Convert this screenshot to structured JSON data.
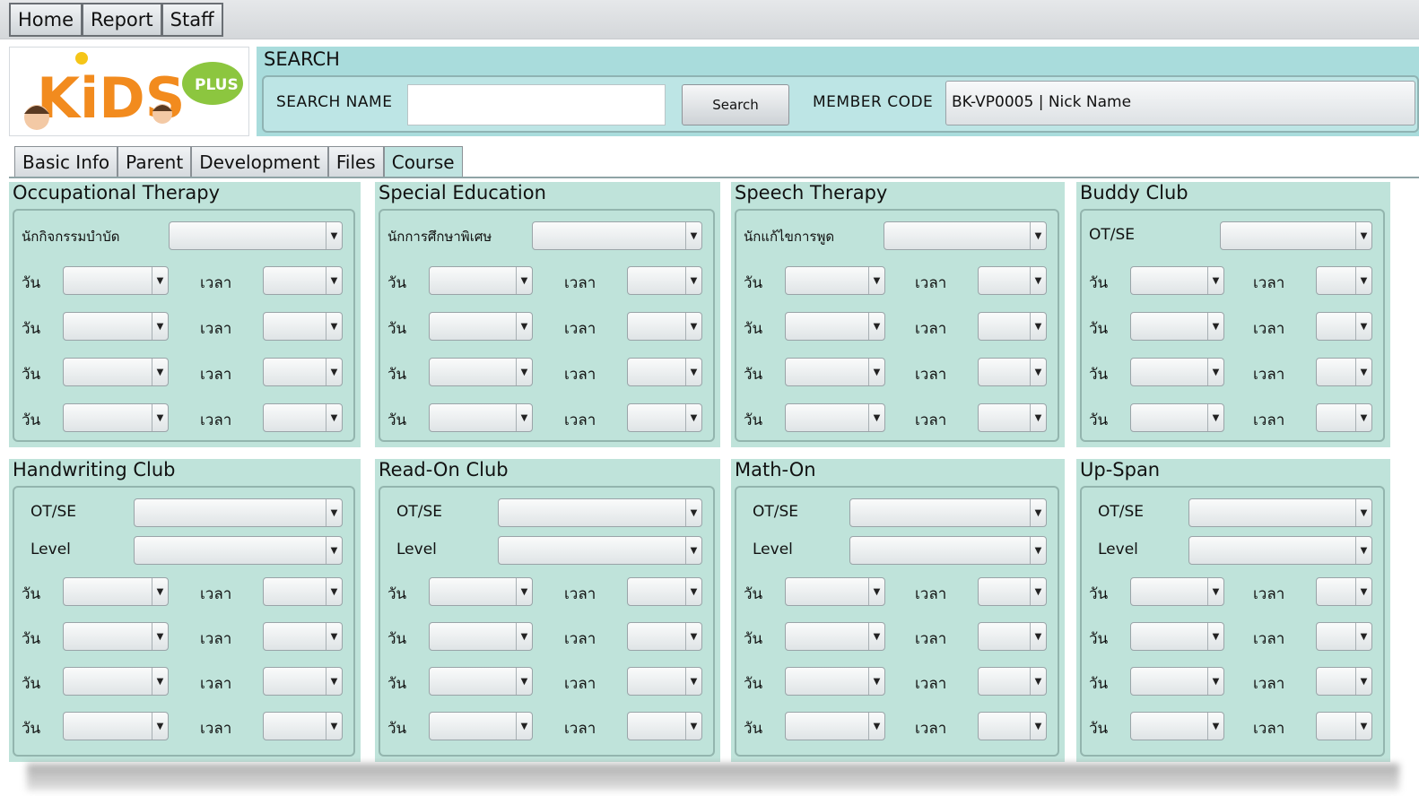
{
  "topmenu": [
    "Home",
    "Report",
    "Staff"
  ],
  "logo": {
    "text": "KiDS",
    "badge": "PLUS"
  },
  "search": {
    "title": "SEARCH",
    "name_label": "SEARCH NAME",
    "name_value": "",
    "button": "Search",
    "code_label": "MEMBER CODE",
    "code_value": "BK-VP0005 | Nick Name"
  },
  "tabs": [
    "Basic Info",
    "Parent",
    "Development",
    "Files",
    "Course"
  ],
  "active_tab": "Course",
  "colors": {
    "panel": "#bfe3da",
    "search_bg": "#a9dcdc"
  },
  "labels": {
    "day": "วัน",
    "time": "เวลา",
    "otse": "OT/SE",
    "level": "Level"
  },
  "panels": [
    {
      "title": "Occupational Therapy",
      "staff_label": "นักกิจกรรมบำบัด"
    },
    {
      "title": "Special Education",
      "staff_label": "นักการศึกษาพิเศษ"
    },
    {
      "title": "Speech Therapy",
      "staff_label": "นักแก้ไขการพูด"
    },
    {
      "title": "Buddy Club",
      "staff_label": "OT/SE"
    },
    {
      "title": "Handwriting Club"
    },
    {
      "title": "Read-On Club"
    },
    {
      "title": "Math-On"
    },
    {
      "title": "Up-Span"
    }
  ]
}
